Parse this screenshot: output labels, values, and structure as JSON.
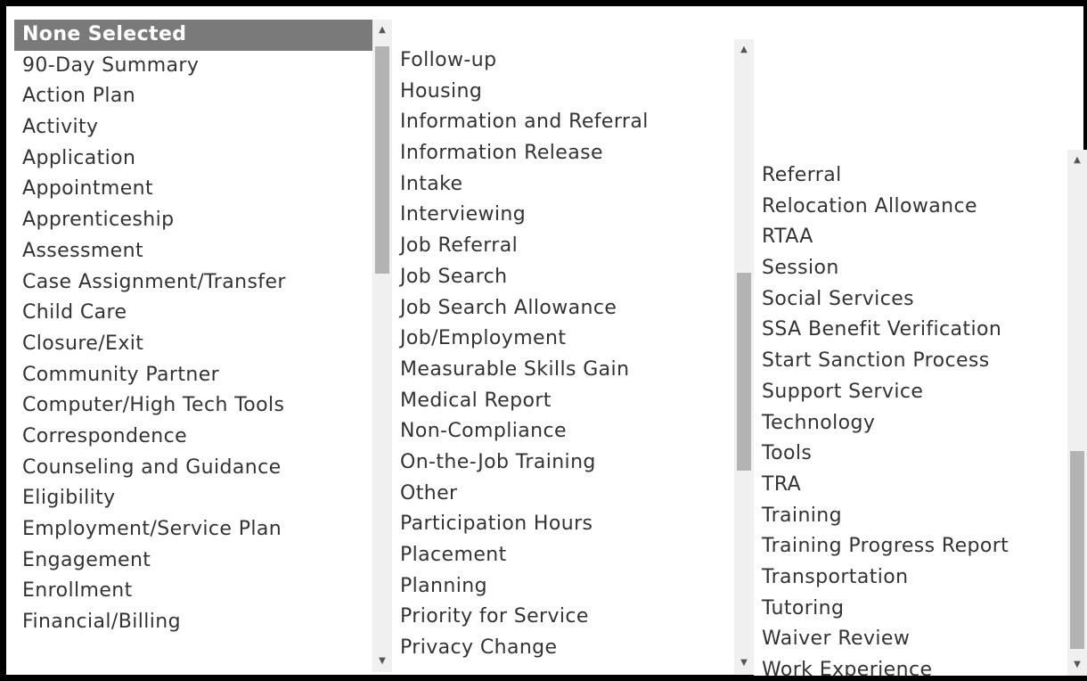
{
  "lists": [
    {
      "items": [
        "None Selected",
        "90-Day Summary",
        "Action Plan",
        "Activity",
        "Application",
        "Appointment",
        "Apprenticeship",
        "Assessment",
        "Case Assignment/Transfer",
        "Child Care",
        "Closure/Exit",
        "Community Partner",
        "Computer/High Tech Tools",
        "Correspondence",
        "Counseling and Guidance",
        "Eligibility",
        "Employment/Service Plan",
        "Engagement",
        "Enrollment",
        "Financial/Billing"
      ],
      "selected_index": 0
    },
    {
      "items": [
        "Follow-up",
        "Housing",
        "Information and Referral",
        "Information Release",
        "Intake",
        "Interviewing",
        "Job Referral",
        "Job Search",
        "Job Search Allowance",
        "Job/Employment",
        "Measurable Skills Gain",
        "Medical Report",
        "Non-Compliance",
        "On-the-Job Training",
        "Other",
        "Participation Hours",
        "Placement",
        "Planning",
        "Priority for Service",
        "Privacy Change"
      ],
      "selected_index": null
    },
    {
      "items": [
        "Referral",
        "Relocation Allowance",
        "RTAA",
        "Session",
        "Social Services",
        "SSA Benefit Verification",
        "Start Sanction Process",
        "Support Service",
        "Technology",
        "Tools",
        "TRA",
        "Training",
        "Training Progress Report",
        "Transportation",
        "Tutoring",
        "Waiver Review",
        "Work Experience"
      ],
      "selected_index": null
    }
  ]
}
